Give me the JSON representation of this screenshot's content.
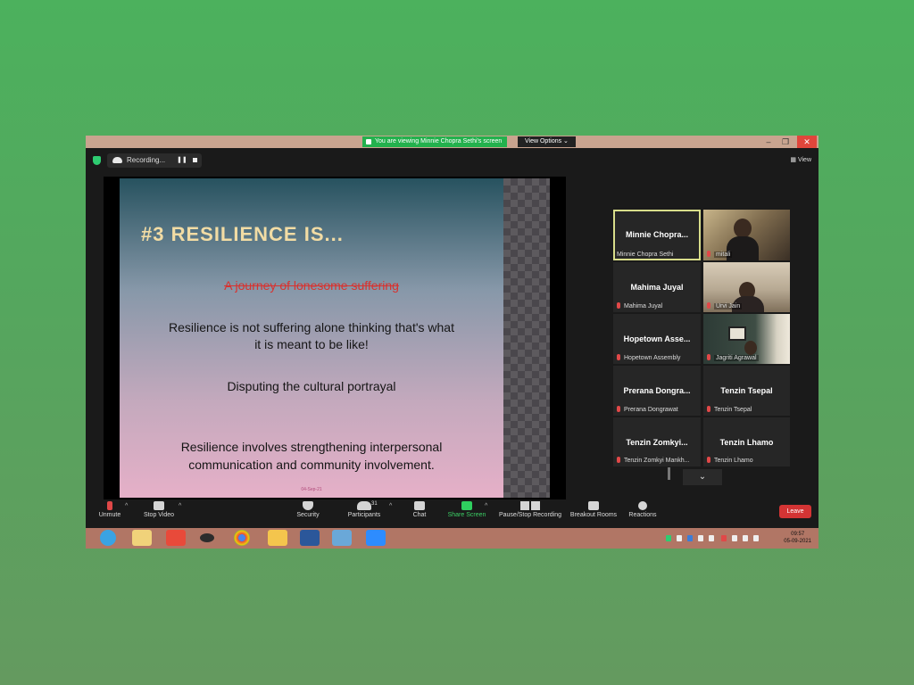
{
  "titlebar": {
    "banner": "You are viewing Minnie Chopra Sethi's screen",
    "view_options": "View Options ⌄",
    "minimize": "–",
    "restore": "❐",
    "close": "✕"
  },
  "topbar": {
    "recording": "Recording...",
    "pause": "❚❚",
    "view": "View"
  },
  "slide": {
    "title": "#3 RESILIENCE IS...",
    "strikethrough": "A journey of lonesome suffering",
    "line1": "Resilience is not suffering alone thinking  that's what",
    "line2": "it  is meant to be like!",
    "line3": "Disputing the cultural portrayal",
    "line4": "Resilience involves strengthening interpersonal",
    "line5": "communication and community involvement.",
    "date": "04-Sep-21"
  },
  "participants": [
    {
      "display": "Minnie  Chopra...",
      "name": "Minnie Chopra Sethi",
      "video": false,
      "active": true
    },
    {
      "display": "",
      "name": "mitali",
      "video": true
    },
    {
      "display": "Mahima Juyal",
      "name": "Mahima Juyal",
      "video": false
    },
    {
      "display": "",
      "name": "Urvi Jain",
      "video": true
    },
    {
      "display": "Hopetown  Asse...",
      "name": "Hopetown Assembly",
      "video": false
    },
    {
      "display": "",
      "name": "Jagriti Agrawal",
      "video": true
    },
    {
      "display": "Prerana  Dongra...",
      "name": "Prerana Dongrawat",
      "video": false
    },
    {
      "display": "Tenzin Tsepal",
      "name": "Tenzin Tsepal",
      "video": false
    },
    {
      "display": "Tenzin  Zomkyi...",
      "name": "Tenzin Zomkyi Mankh...",
      "video": false
    },
    {
      "display": "Tenzin Lhamo",
      "name": "Tenzin Lhamo",
      "video": false
    }
  ],
  "toolbar": {
    "unmute": "Unmute",
    "stop_video": "Stop Video",
    "security": "Security",
    "participants": "Participants",
    "participants_count": "31",
    "chat": "Chat",
    "share_screen": "Share Screen",
    "pause_stop_recording": "Pause/Stop Recording",
    "breakout_rooms": "Breakout Rooms",
    "reactions": "Reactions",
    "leave": "Leave",
    "caret": "^",
    "more_chevron": "⌄"
  },
  "taskbar": {
    "time": "09:57",
    "date": "05-09-2021"
  },
  "colors": {
    "accent_green": "#23b14d",
    "leave_red": "#d33434",
    "active_speaker": "#d8dd8a"
  }
}
